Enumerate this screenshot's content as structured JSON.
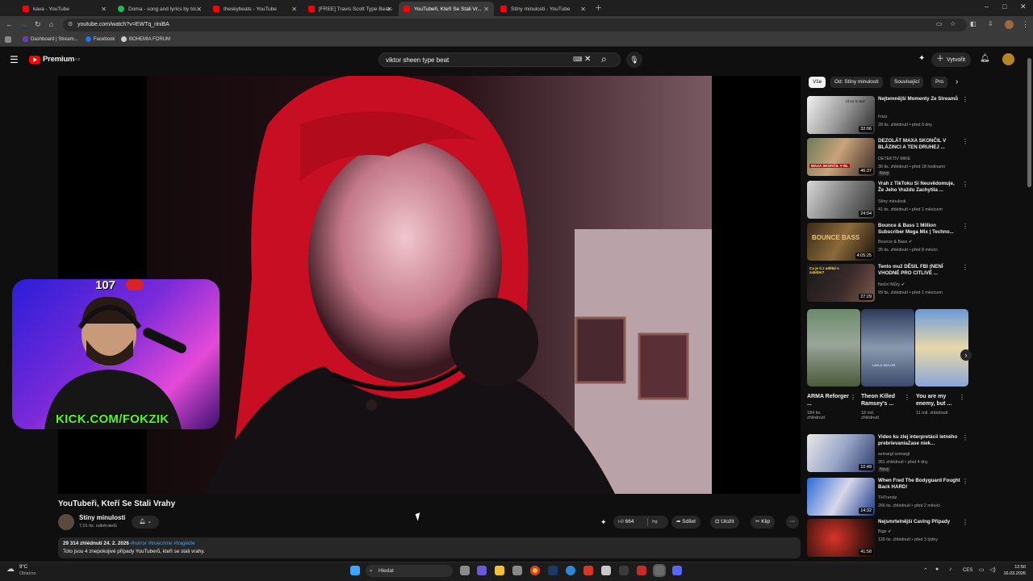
{
  "browser": {
    "tabs": [
      {
        "title": "kava - YouTube",
        "color": "#ff0000"
      },
      {
        "title": "Doma - song and lyrics by toi...",
        "color": "#1db954"
      },
      {
        "title": "theskybeats - YouTube",
        "color": "#ff0000"
      },
      {
        "title": "[FREE] Travis Scott Type Beat -",
        "color": "#ff0000"
      },
      {
        "title": "YouTubeři, Kteří Se Stali Vr...",
        "color": "#ff0000"
      },
      {
        "title": "Stíny minulosti - YouTube",
        "color": "#ff0000"
      }
    ],
    "active_tab": 4,
    "url": "youtube.com/watch?v=EWTq_riniBA",
    "bookmarks": [
      "Dashboard | Stream...",
      "Facebook",
      "BOHEMIA FORUM"
    ]
  },
  "header": {
    "logo": "Premium",
    "logo_sup": "CZ",
    "search_value": "viktor sheen type beat",
    "create_label": "Vytvořit"
  },
  "overlay": {
    "kick_text": "KICK.COM/FOKZIK",
    "counter": "107"
  },
  "video": {
    "title": "YouTubeři, Kteří Se Stali Vrahy",
    "channel": "Stíny minulosti",
    "subscribers": "7,01 tis. odběratelů",
    "likes": "664",
    "share_label": "Sdílet",
    "save_label": "Uložit",
    "clip_label": "Klip",
    "views_date": "29 314 zhlédnutí  24. 2. 2026",
    "hashtags": "#horror #truecrime #tragédie",
    "description": "Toto jsou 4 znepokojivé případy YouTuberů, kteří se stali vrahy."
  },
  "sidebar": {
    "chips": [
      "Vše",
      "Od: Stíny minulosti",
      "Související",
      "Pro"
    ],
    "videos_top": [
      {
        "title": "Nejtemnější Momenty Ze Streamů",
        "channel": "Frizz",
        "meta": "28 tis. zhlédnutí • před 9 dny",
        "duration": "32:06",
        "badge": ""
      },
      {
        "title": "DEZOLÁT MAXA SKONČIL V BLÁZINCI A TEN DRUHEJ ...",
        "channel": "DETEKTIV MIKE",
        "meta": "36 tis. zhlédnutí • před 18 hodinami",
        "duration": "46:37",
        "badge": "Nový"
      },
      {
        "title": "Vrah z TikToku Si Neuvědomuje, Že Jeho Vraždu Zachytila ...",
        "channel": "Stíny minulosti",
        "meta": "41 tis. zhlédnutí • před 1 měsícem",
        "duration": "24:04",
        "badge": ""
      },
      {
        "title": "Bounce & Bass 1 Million Subscriber Mega Mix | Techno...",
        "channel": "Bounce & Bass",
        "meta": "35 tis. zhlédnutí • před 8 měsíci",
        "duration": "4:05:25",
        "badge": ""
      },
      {
        "title": "Tento muž DĚSIL FBI (NENÍ VHODNÉ PRO CITLIVÉ ...",
        "channel": "Noční Můry",
        "meta": "99 tis. zhlédnutí • před 1 měsícem",
        "duration": "27:29",
        "badge": ""
      }
    ],
    "shorts": [
      {
        "title": "ARMA Reforger ...",
        "views": "184 tis. zhlédnutí"
      },
      {
        "title": "Theon Killed Ramsey's ...",
        "views": "18 mil. zhlédnutí"
      },
      {
        "title": "You are my enemy, but ...",
        "views": "11 mil. zhlédnutí"
      }
    ],
    "shorts_thumb_caption": "LAYLA TAYLOR",
    "videos_bottom": [
      {
        "title": "Video ku zlej interpretácii letného prebrievaniaZase niek...",
        "channel": "semargl semargl",
        "meta": "361 zhlédnutí • před 4 dny",
        "duration": "10:49",
        "badge": "Nový"
      },
      {
        "title": "When Fred The Bodyguard Fought Back HARD!",
        "channel": "THTrendz",
        "meta": "266 tis. zhlédnutí • před 2 měsíci",
        "duration": "14:32",
        "badge": ""
      },
      {
        "title": "Nejsmrtelnější Caving Případy",
        "channel": "Bige",
        "meta": "126 tis. zhlédnutí • před 3 týdny",
        "duration": "41:58",
        "badge": ""
      }
    ],
    "thumb_captions": {
      "t0": "Chce to teď",
      "t1": "MAXA SKONČIL V BL",
      "t3": "BOUNCE BASS",
      "t4": "Co je ti z udělal o zabitím?"
    }
  },
  "taskbar": {
    "weather_temp": "9°C",
    "weather_text": "Oblačno",
    "search_label": "Hledat",
    "lang": "CES",
    "time": "12:50",
    "date": "16.03.2026"
  }
}
